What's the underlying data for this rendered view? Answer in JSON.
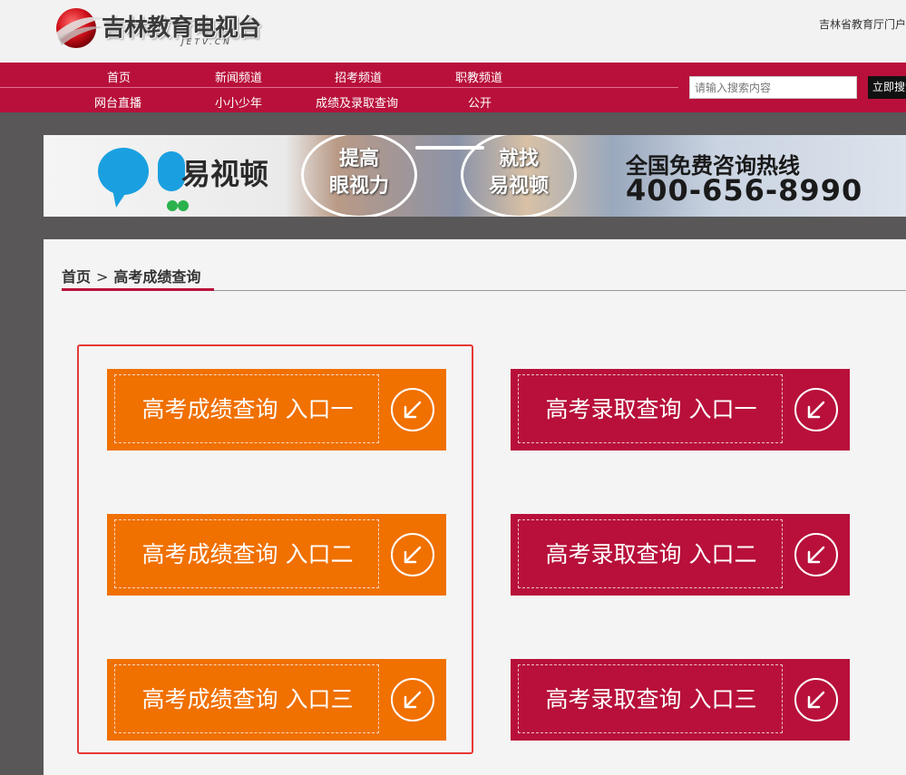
{
  "header": {
    "logo_text": "吉林教育电视台",
    "logo_sub": "JETV.CN",
    "top_link": "吉林省教育厅门户"
  },
  "nav": {
    "row1": [
      "首页",
      "新闻频道",
      "招考频道",
      "职教频道"
    ],
    "row2": [
      "网台直播",
      "小小少年",
      "成绩及录取查询",
      "公开"
    ],
    "search_placeholder": "请输入搜索内容",
    "search_button": "立即搜索"
  },
  "banner": {
    "brand": "易视顿",
    "lens1": [
      "提高",
      "眼视力"
    ],
    "lens2": [
      "就找",
      "易视顿"
    ],
    "hotline_label": "全国免费咨询热线",
    "hotline_number": "400-656-8990"
  },
  "breadcrumb": {
    "home": "首页",
    "separator": ">",
    "current": "高考成绩查询"
  },
  "entries": {
    "score": [
      "高考成绩查询 入口一",
      "高考成绩查询 入口二",
      "高考成绩查询 入口三"
    ],
    "admission": [
      "高考录取查询 入口一",
      "高考录取查询 入口二",
      "高考录取查询 入口三"
    ]
  },
  "colors": {
    "brand_red": "#b8103a",
    "orange": "#f07000",
    "highlight": "#e53935",
    "dark_band": "#595757"
  }
}
